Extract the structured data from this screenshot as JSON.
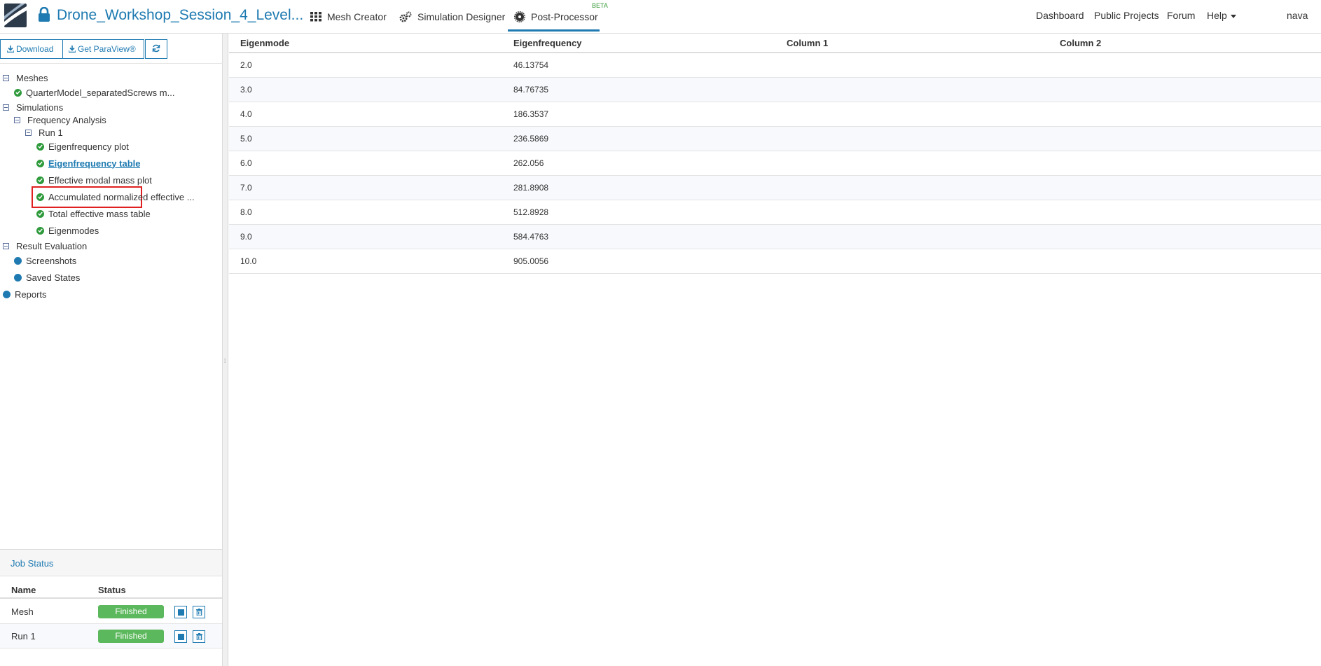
{
  "header": {
    "project_title": "Drone_Workshop_Session_4_Level...",
    "nav": [
      {
        "label": "Mesh Creator",
        "icon": "grid-icon"
      },
      {
        "label": "Simulation Designer",
        "icon": "gears-icon"
      },
      {
        "label": "Post-Processor",
        "icon": "gear-icon",
        "badge": "BETA",
        "active": true
      }
    ],
    "right_links": [
      "Dashboard",
      "Public Projects",
      "Forum",
      "Help",
      "nava"
    ]
  },
  "toolbar": {
    "download_label": "Download",
    "paraview_label": "Get ParaView®"
  },
  "tree": {
    "meshes_label": "Meshes",
    "mesh_item": "QuarterModel_separatedScrews m...",
    "simulations_label": "Simulations",
    "frequency_analysis": "Frequency Analysis",
    "run1": "Run 1",
    "items": [
      "Eigenfrequency plot",
      "Eigenfrequency table",
      "Effective modal mass plot",
      "Accumulated normalized effective ...",
      "Total effective mass table",
      "Eigenmodes"
    ],
    "result_evaluation": "Result Evaluation",
    "screenshots": "Screenshots",
    "saved_states": "Saved States",
    "reports": "Reports"
  },
  "job_status": {
    "title": "Job Status",
    "col_name": "Name",
    "col_status": "Status",
    "rows": [
      {
        "name": "Mesh",
        "status": "Finished"
      },
      {
        "name": "Run 1",
        "status": "Finished"
      }
    ]
  },
  "table": {
    "headers": [
      "Eigenmode",
      "Eigenfrequency",
      "Column 1",
      "Column 2"
    ],
    "rows": [
      [
        "2.0",
        "46.13754"
      ],
      [
        "3.0",
        "84.76735"
      ],
      [
        "4.0",
        "186.3537"
      ],
      [
        "5.0",
        "236.5869"
      ],
      [
        "6.0",
        "262.056"
      ],
      [
        "7.0",
        "281.8908"
      ],
      [
        "8.0",
        "512.8928"
      ],
      [
        "9.0",
        "584.4763"
      ],
      [
        "10.0",
        "905.0056"
      ]
    ]
  },
  "colors": {
    "accent": "#1e7ab1",
    "success": "#5cb85c",
    "highlight": "#e02020"
  }
}
